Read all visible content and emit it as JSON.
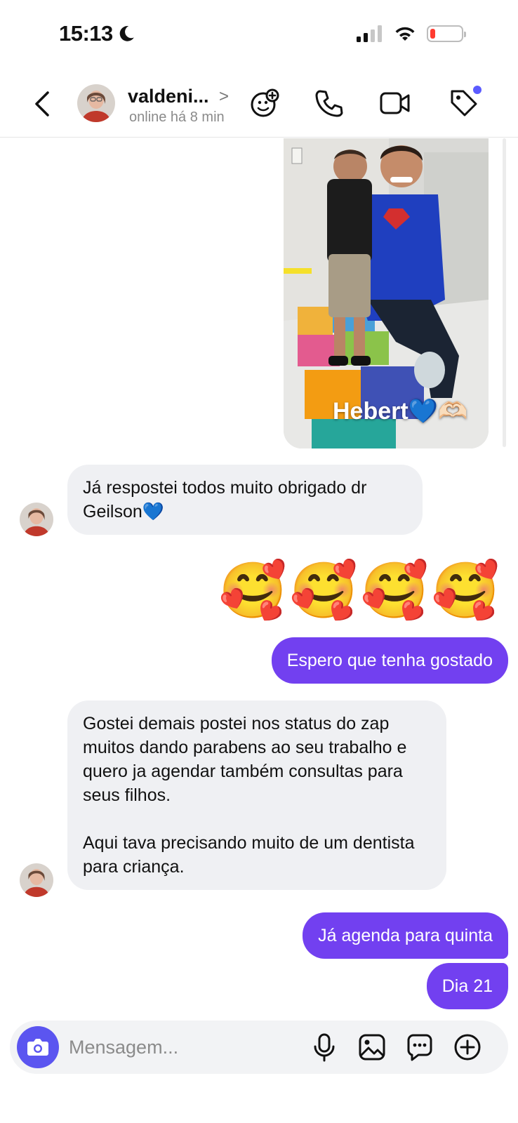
{
  "status_bar": {
    "time": "15:13",
    "battery_level": 0.15
  },
  "header": {
    "contact_name": "valdeni...",
    "chevron": ">",
    "status": "online há 8 min"
  },
  "photo": {
    "caption": "Hebert💙🫶🏻"
  },
  "messages": [
    {
      "direction": "in",
      "text": "Já respostei todos muito obrigado dr Geilson💙"
    },
    {
      "direction": "out",
      "text": "🥰🥰🥰🥰"
    },
    {
      "direction": "out",
      "text": "Espero que tenha gostado"
    },
    {
      "direction": "in",
      "text": "Gostei demais postei nos status do zap muitos dando parabens ao seu trabalho e quero ja agendar também consultas para seus filhos.\n\nAqui tava precisando muito de um dentista para criança."
    },
    {
      "direction": "out",
      "text": "Já agenda para quinta"
    },
    {
      "direction": "out",
      "text": "Dia 21"
    }
  ],
  "composer": {
    "placeholder": "Mensagem..."
  },
  "colors": {
    "outgoing_bubble": "#7240f0",
    "incoming_bubble": "#eff0f3",
    "camera_button": "#5b55f0"
  }
}
